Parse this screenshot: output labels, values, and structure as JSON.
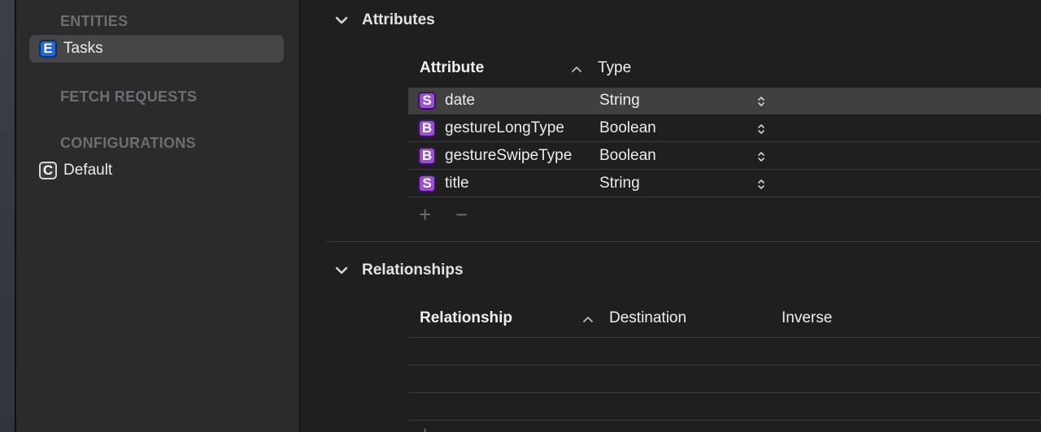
{
  "sidebar": {
    "entities_header": "ENTITIES",
    "entities": [
      {
        "badge": "E",
        "label": "Tasks",
        "selected": true
      }
    ],
    "fetch_requests_header": "FETCH REQUESTS",
    "configurations_header": "CONFIGURATIONS",
    "configurations": [
      {
        "badge": "C",
        "label": "Default"
      }
    ]
  },
  "attributes": {
    "section_title": "Attributes",
    "col_attribute": "Attribute",
    "col_type": "Type",
    "rows": [
      {
        "badge": "S",
        "name": "date",
        "type": "String",
        "selected": true
      },
      {
        "badge": "B",
        "name": "gestureLongType",
        "type": "Boolean"
      },
      {
        "badge": "B",
        "name": "gestureSwipeType",
        "type": "Boolean"
      },
      {
        "badge": "S",
        "name": "title",
        "type": "String"
      }
    ],
    "add_label": "+",
    "remove_label": "−"
  },
  "relationships": {
    "section_title": "Relationships",
    "col_relationship": "Relationship",
    "col_destination": "Destination",
    "col_inverse": "Inverse",
    "add_label": "+"
  },
  "colors": {
    "entity_badge": "#2467d6",
    "attribute_badge": "#9b4fd2",
    "selected_row": "#404043"
  },
  "icons": {
    "section_toggle": "chevron-down-icon",
    "sort": "chevron-up-icon",
    "type_popup": "up-down-chevron-icon"
  }
}
